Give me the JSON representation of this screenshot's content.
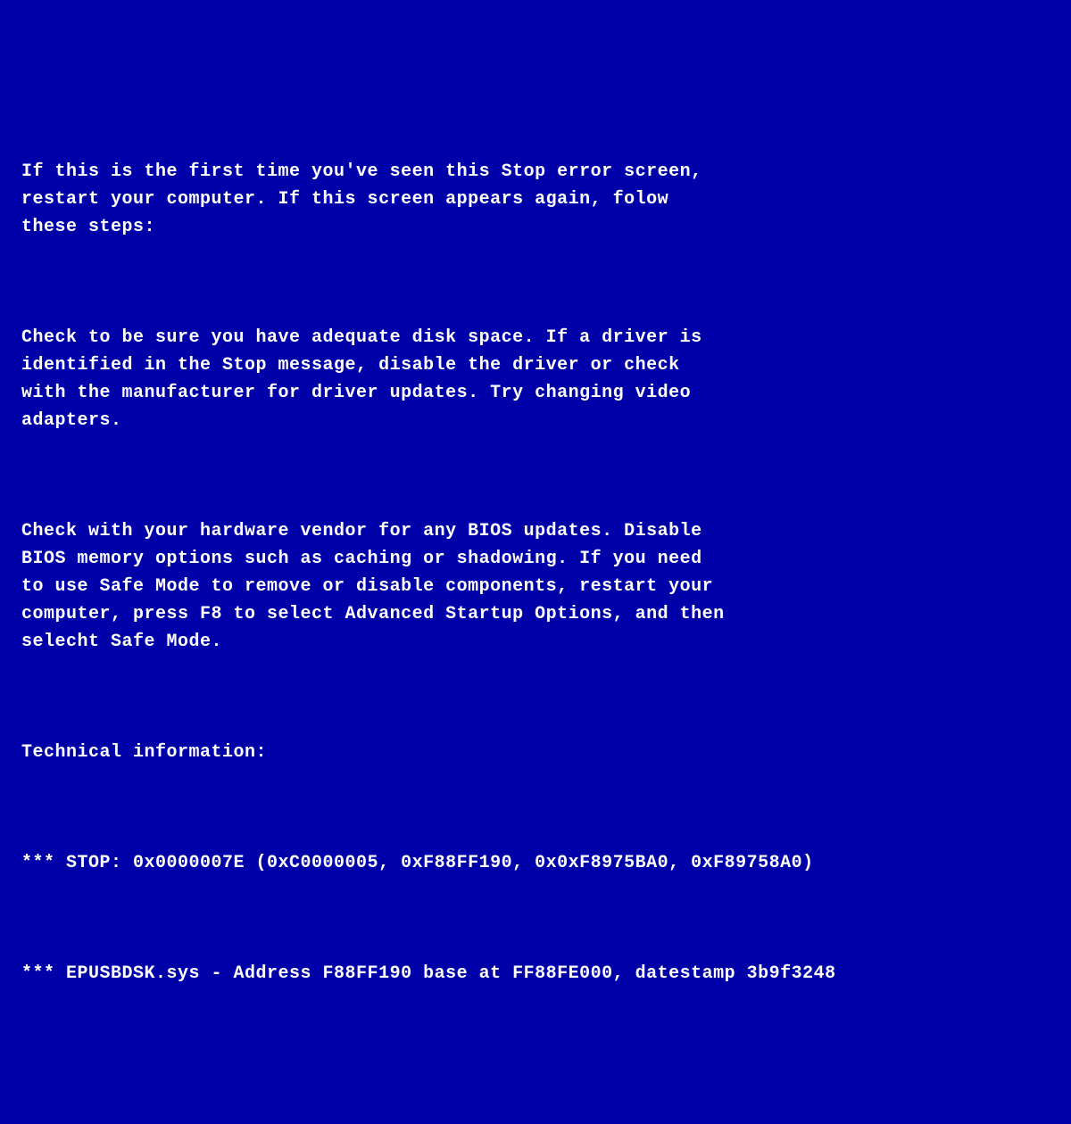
{
  "bsod": {
    "paragraphs": {
      "p1": "If this is the first time you've seen this Stop error screen,\nrestart your computer. If this screen appears again, folow\nthese steps:",
      "p2": "Check to be sure you have adequate disk space. If a driver is\nidentified in the Stop message, disable the driver or check\nwith the manufacturer for driver updates. Try changing video\nadapters.",
      "p3": "Check with your hardware vendor for any BIOS updates. Disable\nBIOS memory options such as caching or shadowing. If you need\nto use Safe Mode to remove or disable components, restart your\ncomputer, press F8 to select Advanced Startup Options, and then\nselecht Safe Mode.",
      "p4": "Technical information:",
      "p5": "*** STOP: 0x0000007E (0xC0000005, 0xF88FF190, 0x0xF8975BA0, 0xF89758A0)",
      "p6": "*** EPUSBDSK.sys - Address F88FF190 base at FF88FE000, datestamp 3b9f3248"
    }
  }
}
